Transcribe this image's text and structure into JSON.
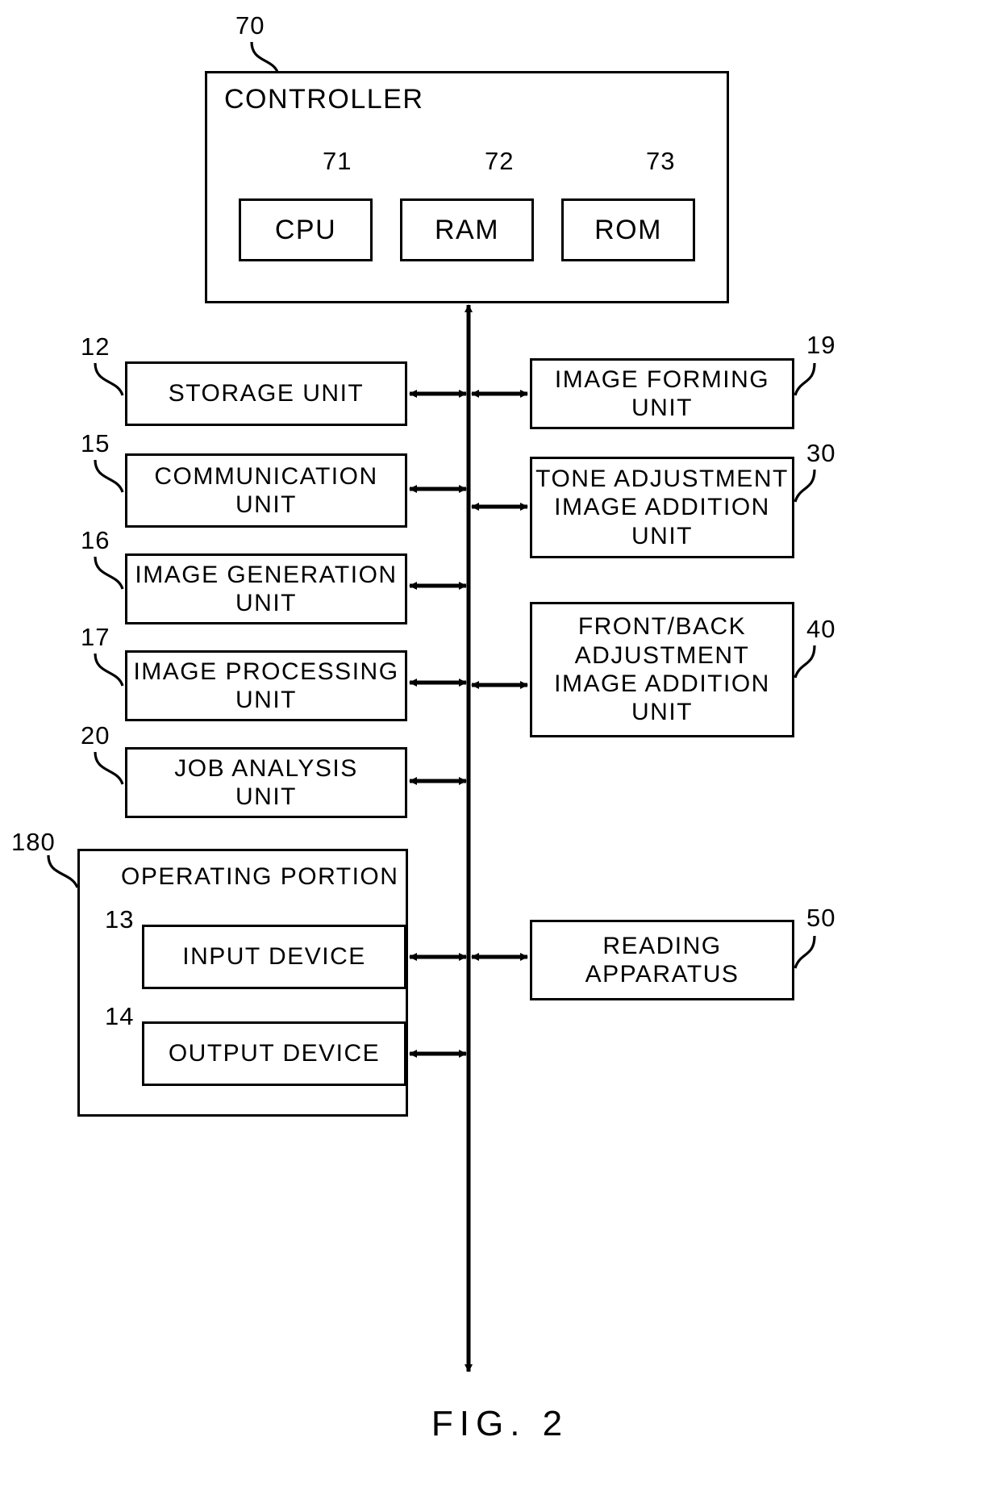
{
  "figure": {
    "caption": "FIG.  2"
  },
  "controller": {
    "ref": "70",
    "title": "CONTROLLER",
    "components": [
      {
        "ref": "71",
        "label": "CPU"
      },
      {
        "ref": "72",
        "label": "RAM"
      },
      {
        "ref": "73",
        "label": "ROM"
      }
    ]
  },
  "left_column": [
    {
      "ref": "12",
      "label": "STORAGE UNIT"
    },
    {
      "ref": "15",
      "label": "COMMUNICATION\nUNIT"
    },
    {
      "ref": "16",
      "label": "IMAGE GENERATION\nUNIT"
    },
    {
      "ref": "17",
      "label": "IMAGE PROCESSING\nUNIT"
    },
    {
      "ref": "20",
      "label": "JOB ANALYSIS\nUNIT"
    }
  ],
  "right_column": [
    {
      "ref": "19",
      "label": "IMAGE FORMING\nUNIT"
    },
    {
      "ref": "30",
      "label": "TONE ADJUSTMENT\nIMAGE ADDITION\nUNIT"
    },
    {
      "ref": "40",
      "label": "FRONT/BACK\nADJUSTMENT\nIMAGE ADDITION\nUNIT"
    },
    {
      "ref": "50",
      "label": "READING\nAPPARATUS"
    }
  ],
  "operating_portion": {
    "ref": "180",
    "title": "OPERATING PORTION",
    "components": [
      {
        "ref": "13",
        "label": "INPUT DEVICE"
      },
      {
        "ref": "14",
        "label": "OUTPUT DEVICE"
      }
    ]
  },
  "colors": {
    "line": "#000000",
    "background": "#ffffff"
  }
}
